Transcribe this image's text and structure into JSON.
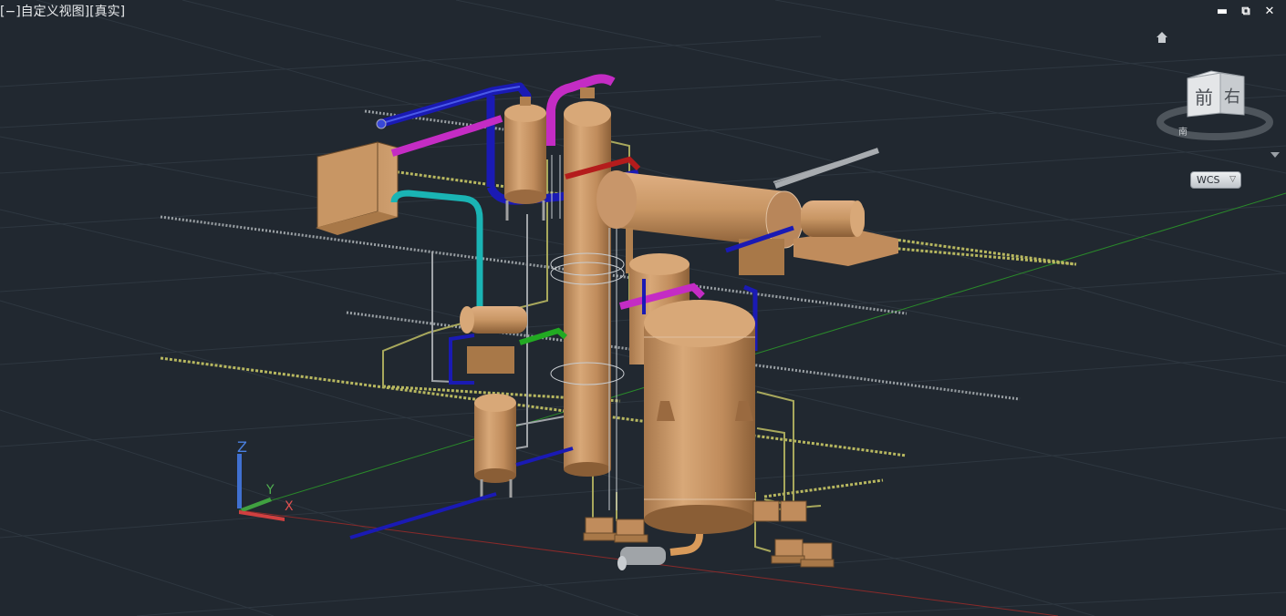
{
  "viewport": {
    "label": "[−]自定义视图][真实]"
  },
  "window_controls": {
    "minimize_icon": "minimize-icon",
    "restore_icon": "restore-icon",
    "close_icon": "close-icon",
    "minimize_glyph": "▬",
    "restore_glyph": "⧉",
    "close_glyph": "✕"
  },
  "navigation": {
    "home_icon": "home-icon",
    "viewcube": {
      "face_front": "前",
      "face_right": "右",
      "compass_label": "南"
    },
    "coordinate_system": {
      "label": "WCS",
      "arrow": "▽"
    }
  },
  "ucs_icon": {
    "x_label": "X",
    "y_label": "Y",
    "z_label": "Z"
  },
  "colors": {
    "background": "#212830",
    "grid": "#2e3740",
    "vessel": "#c89664",
    "pipe_blue": "#1a1ab4",
    "pipe_magenta": "#c42cc4",
    "pipe_cyan": "#1ab4b4",
    "pipe_green": "#22aa22",
    "pipe_red": "#b41c1c",
    "pipe_yellow": "#b4b460",
    "pipe_gray": "#a0a0a0",
    "axis_x": "#d04040",
    "axis_y": "#40a040",
    "axis_z": "#4070d0"
  }
}
